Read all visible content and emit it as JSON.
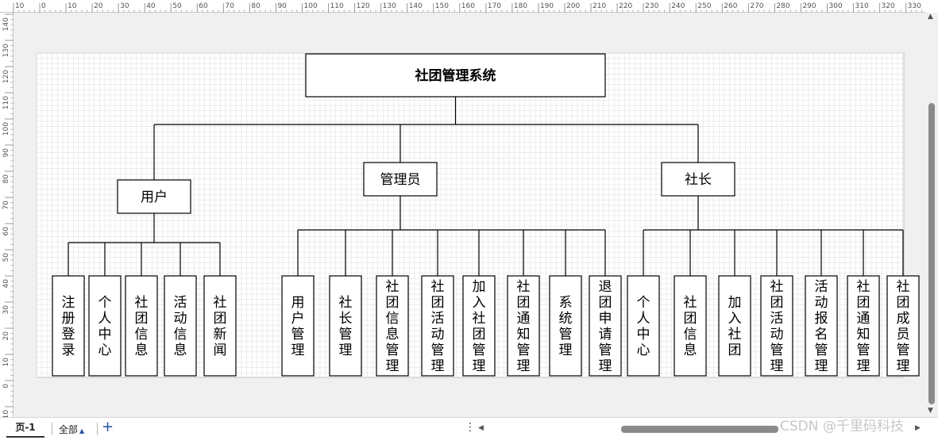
{
  "diagram": {
    "root": "社团管理系统",
    "roles": [
      {
        "label": "用户",
        "children": [
          "注册登录",
          "个人中心",
          "社团信息",
          "活动信息",
          "社团新闻"
        ]
      },
      {
        "label": "管理员",
        "children": [
          "用户管理",
          "社长管理",
          "社团信息管理",
          "社团活动管理",
          "加入社团管理",
          "社团通知管理",
          "系统管理",
          "退团申请管理"
        ]
      },
      {
        "label": "社长",
        "children": [
          "个人中心",
          "社团信息",
          "加入社团",
          "社团活动管理",
          "活动报名管理",
          "社团通知管理",
          "社团成员管理"
        ]
      }
    ]
  },
  "rulers": {
    "horizontal_ticks": [
      "10",
      "0",
      "10",
      "20",
      "30",
      "40",
      "50",
      "60",
      "70",
      "80",
      "90",
      "100",
      "110",
      "120",
      "130",
      "140",
      "150",
      "160",
      "170",
      "180",
      "190",
      "200",
      "210",
      "220",
      "230",
      "240",
      "250",
      "260",
      "270",
      "280",
      "290",
      "300",
      "310",
      "320",
      "330"
    ],
    "vertical_ticks": [
      "140",
      "130",
      "120",
      "110",
      "100",
      "90",
      "80",
      "70",
      "60",
      "50",
      "40",
      "30",
      "20",
      "10",
      "0",
      "10"
    ]
  },
  "bottom_bar": {
    "page_tab": "页-1",
    "all_pages": "全部",
    "add_icon": "plus-icon",
    "menu_icon": "more-vertical-icon"
  },
  "watermark": "CSDN @千里码科技",
  "colors": {
    "background": "#f0f0f0",
    "paper": "#ffffff",
    "grid": "#d8d8d8",
    "line": "#000000"
  }
}
